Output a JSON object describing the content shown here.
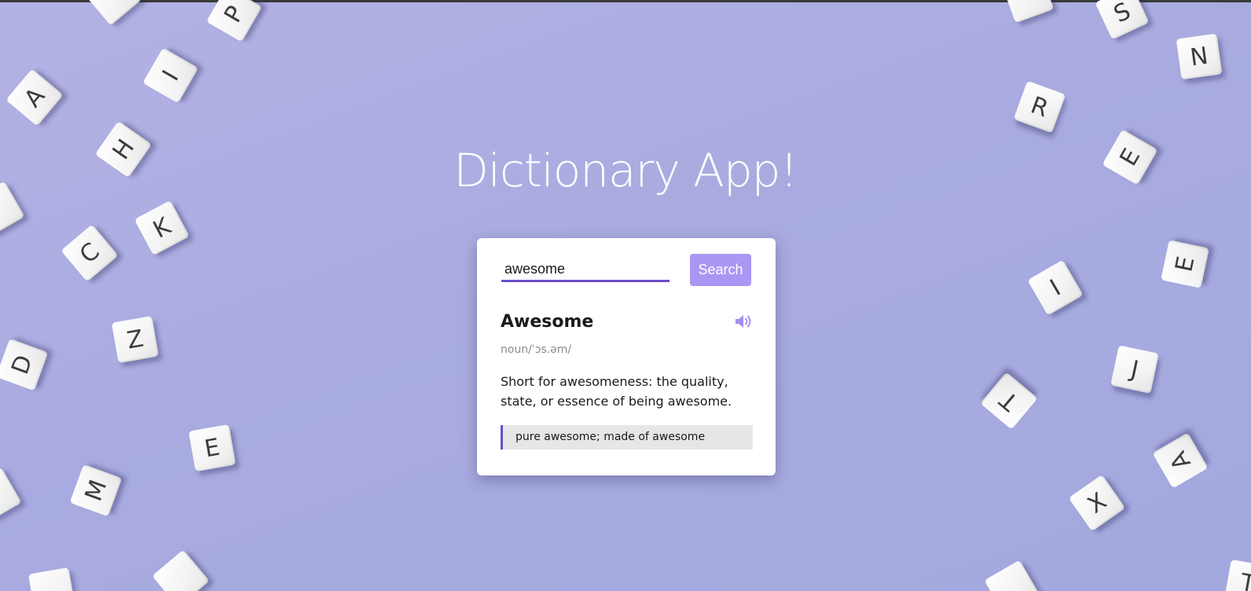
{
  "app": {
    "title": "Dictionary App!"
  },
  "search": {
    "value": "awesome",
    "placeholder": "",
    "button_label": "Search"
  },
  "result": {
    "word": "Awesome",
    "phonetic": "noun/ˈɔs.əm/",
    "meaning": "Short for awesomeness: the quality, state, or essence of being awesome.",
    "example": "pure awesome; made of awesome",
    "sound_icon": "speaker-volume-icon"
  },
  "background_tiles": [
    "S",
    "N",
    "R",
    "E",
    "E",
    "I",
    "J",
    "T",
    "A",
    "X",
    "T",
    "A",
    "I",
    "H",
    "K",
    "C",
    "Z",
    "D",
    "E",
    "M",
    "P"
  ],
  "colors": {
    "accent": "#6a4cc9",
    "button": "#ab96f4",
    "icon": "#a48cf0",
    "background": "#aaabe0",
    "card": "#ffffff"
  }
}
